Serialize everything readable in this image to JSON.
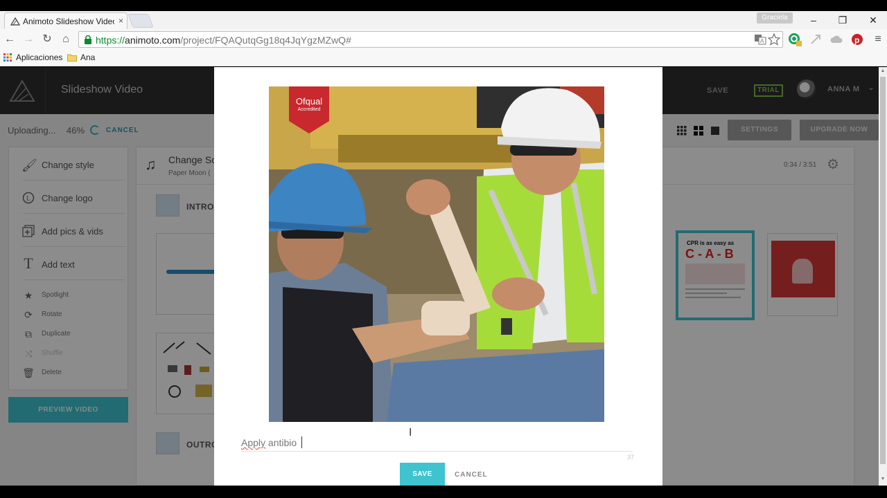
{
  "browser": {
    "tab_title": "Animoto Slideshow Video",
    "tab_close": "×",
    "profile_name": "Graciela",
    "url_scheme": "https://",
    "url_host": "animoto.com",
    "url_path": "/project/FQAQutqGg18q4JqYgzMZwQ#",
    "bookmarks": {
      "apps": "Aplicaciones",
      "folder": "Ana"
    },
    "icons": [
      "back-arrow-icon",
      "forward-arrow-icon",
      "reload-icon",
      "home-icon",
      "lock-icon",
      "translate-icon",
      "star-icon",
      "extension-icon",
      "pinterest-icon",
      "menu-icon"
    ]
  },
  "app": {
    "title": "Slideshow Video",
    "save_label": "SAVE",
    "trial_label": "TRIAL",
    "user_name": "ANNA M",
    "uploading_label": "Uploading...",
    "uploading_percent": "46%",
    "upload_cancel": "CANCEL",
    "settings_label": "SETTINGS",
    "upgrade_label": "UPGRADE NOW",
    "sidebar": {
      "items": [
        {
          "label": "Change style",
          "icon": "brush-icon"
        },
        {
          "label": "Change logo",
          "icon": "logo-icon"
        },
        {
          "label": "Add pics & vids",
          "icon": "add-pics-icon"
        },
        {
          "label": "Add text",
          "icon": "text-icon"
        }
      ],
      "small_items": [
        {
          "label": "Spotlight",
          "icon": "star-icon"
        },
        {
          "label": "Rotate",
          "icon": "rotate-icon"
        },
        {
          "label": "Duplicate",
          "icon": "duplicate-icon"
        },
        {
          "label": "Shuffle",
          "icon": "shuffle-icon"
        },
        {
          "label": "Delete",
          "icon": "trash-icon"
        }
      ]
    },
    "preview_label": "PREVIEW VIDEO",
    "storyboard": {
      "song_title": "Change So",
      "song_sub": "Paper Moon (",
      "timecode": "0:34 / 3:51",
      "intro_label": "INTRO",
      "outro_label": "OUTRO"
    }
  },
  "modal": {
    "badge_title": "Ofqual",
    "badge_sub": "Accredited",
    "caption_word1": "Apply",
    "caption_word2": "antibio",
    "char_count": "37",
    "save_label": "SAVE",
    "cancel_label": "CANCEL"
  },
  "colors": {
    "accent": "#3ec3cf",
    "header": "#2e2e2e",
    "trial": "#7ec24a",
    "badge": "#c8282e"
  }
}
